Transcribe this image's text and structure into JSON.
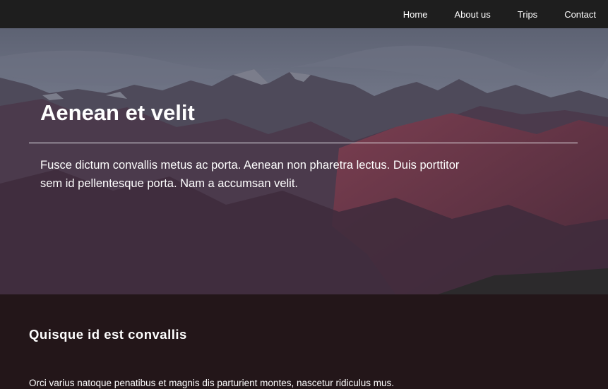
{
  "nav": {
    "items": [
      {
        "label": "Home"
      },
      {
        "label": "About us"
      },
      {
        "label": "Trips"
      },
      {
        "label": "Contact"
      }
    ]
  },
  "hero": {
    "title": "Aenean et velit",
    "text": "Fusce dictum convallis metus ac porta. Aenean non pharetra lectus. Duis porttitor sem id pellentesque porta. Nam a accumsan velit."
  },
  "section": {
    "title": "Quisque id est convallis",
    "text": "Orci varius natoque penatibus et magnis dis parturient montes, nascetur ridiculus mus."
  },
  "colors": {
    "navbar": "#1e1e1e",
    "content_background": "#231619",
    "text": "#ffffff"
  }
}
